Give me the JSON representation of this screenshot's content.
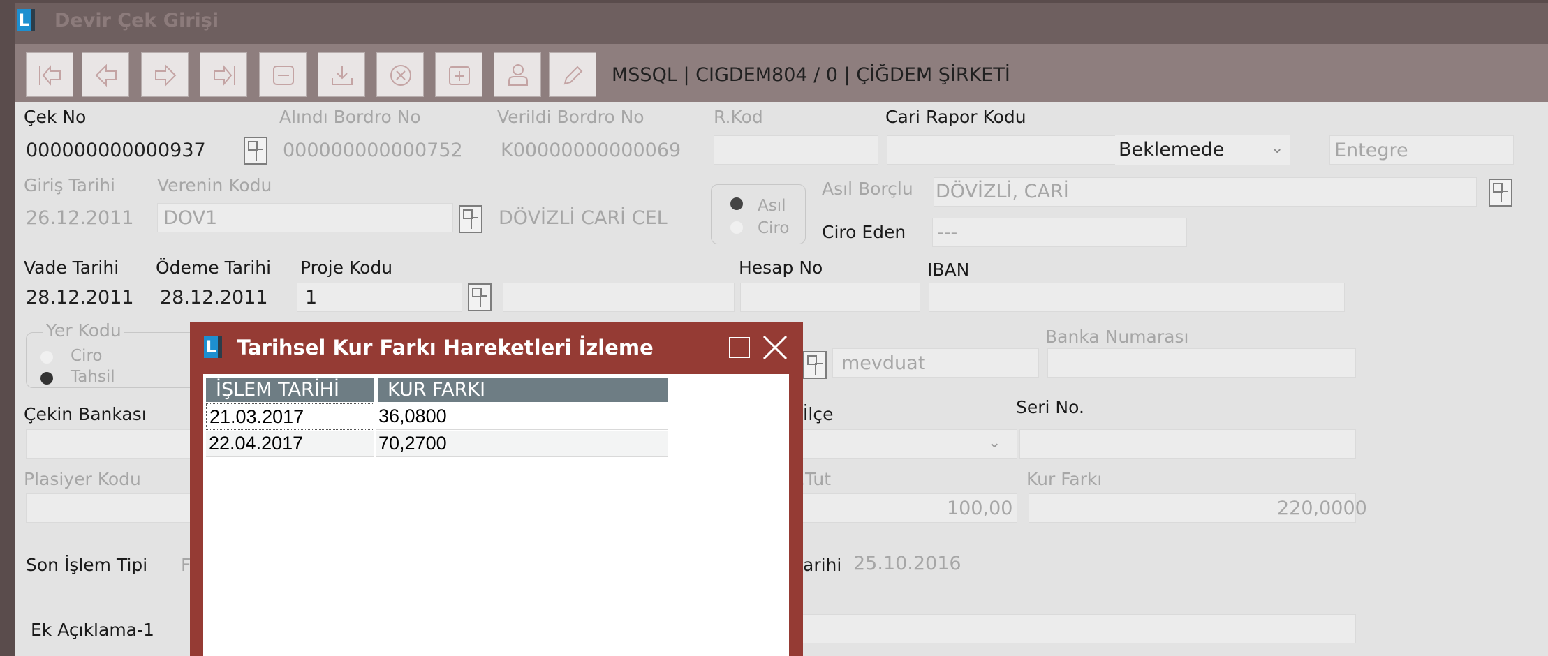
{
  "window": {
    "title": "Devir Çek Girişi",
    "app_logo": "L"
  },
  "toolbar": {
    "buttons": [
      "first-record-icon",
      "previous-record-icon",
      "next-record-icon",
      "last-record-icon",
      "list-icon",
      "download-icon",
      "cancel-icon",
      "new-record-icon",
      "user-icon",
      "edit-icon"
    ],
    "status": "MSSQL | CIGDEM804 / 0 | ÇİĞDEM ŞİRKETİ"
  },
  "form": {
    "cek_no": {
      "label": "Çek No",
      "value": "000000000000937"
    },
    "alindi_bordro_no": {
      "label": "Alındı Bordro No",
      "value": "000000000000752"
    },
    "verildi_bordro_no": {
      "label": "Verildi Bordro No",
      "value": "K00000000000069"
    },
    "r_kod": {
      "label": "R.Kod",
      "value": ""
    },
    "cari_rapor_kodu": {
      "label": "Cari Rapor Kodu",
      "value": ""
    },
    "durum": {
      "value": "Beklemede"
    },
    "entegre": {
      "value": "Entegre"
    },
    "giris_tarihi": {
      "label": "Giriş Tarihi",
      "value": "26.12.2011"
    },
    "verenin_kodu": {
      "label": "Verenin Kodu",
      "value": "DOV1",
      "name": "DÖVİZLİ CARİ CEL"
    },
    "asil_ciro": {
      "options": [
        "Asıl",
        "Ciro"
      ],
      "selected": "Asıl"
    },
    "asil_borclu": {
      "label": "Asıl Borçlu",
      "value": "DÖVİZLİ, CARİ"
    },
    "ciro_eden": {
      "label": "Ciro Eden",
      "value": "---"
    },
    "vade_tarihi": {
      "label": "Vade Tarihi",
      "value": "28.12.2011"
    },
    "odeme_tarihi": {
      "label": "Ödeme Tarihi",
      "value": "28.12.2011"
    },
    "proje_kodu": {
      "label": "Proje Kodu",
      "value": "1"
    },
    "hesap_no": {
      "label": "Hesap No",
      "value": ""
    },
    "iban": {
      "label": "IBAN",
      "value": ""
    },
    "yer_kodu": {
      "label": "Yer Kodu",
      "options": [
        "Ciro",
        "Tahsil"
      ],
      "selected": "Tahsil"
    },
    "hesap_tipi": {
      "value": "mevduat"
    },
    "banka_numarasi": {
      "label": "Banka Numarası",
      "value": ""
    },
    "cekin_bankasi": {
      "label": "Çekin Bankası"
    },
    "ilce": {
      "label": "İlçe"
    },
    "seri_no": {
      "label": "Seri No."
    },
    "plasiyer_kodu": {
      "label": "Plasiyer Kodu"
    },
    "tutar": {
      "label": ".Tut",
      "value": "100,00"
    },
    "kur_farki": {
      "label": "Kur Farkı",
      "value": "220,0000"
    },
    "son_islem_tipi": {
      "label": "Son İşlem Tipi",
      "partial": "F"
    },
    "son_islem_tarihi": {
      "label": "arihi",
      "value": "25.10.2016"
    },
    "ek_aciklama_1": {
      "label": "Ek Açıklama-1"
    }
  },
  "dialog": {
    "title": "Tarihsel Kur Farkı Hareketleri İzleme",
    "columns": [
      "İŞLEM TARİHİ",
      "KUR FARKI"
    ],
    "rows": [
      {
        "tarih": "21.03.2017",
        "kur_farki": "36,0800"
      },
      {
        "tarih": "22.04.2017",
        "kur_farki": "70,2700"
      }
    ]
  },
  "colors": {
    "window_frame": "#5a4c4c",
    "toolbar": "#8e7e7e",
    "dialog_frame": "#953b34",
    "table_header": "#6e7d84"
  }
}
